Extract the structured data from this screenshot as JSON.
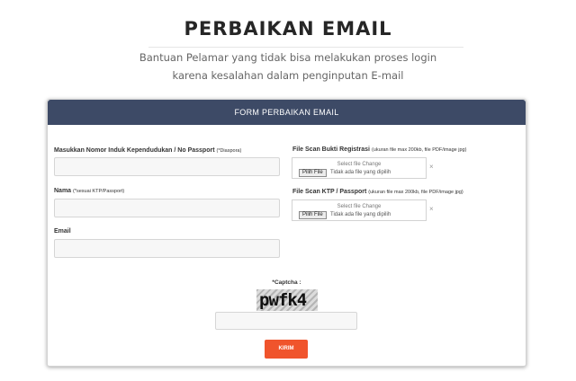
{
  "page": {
    "title": "PERBAIKAN EMAIL",
    "subtitle_line1": "Bantuan Pelamar yang tidak bisa melakukan proses login",
    "subtitle_line2": "karena kesalahan dalam penginputan E-mail"
  },
  "form": {
    "header": "FORM PERBAIKAN EMAIL",
    "nik_label": "Masukkan Nomor Induk Kependudukan / No Passport",
    "nik_note": "(*Diaspora)",
    "nik_value": "",
    "nama_label": "Nama",
    "nama_note": "(*sesuai KTP/Passport)",
    "nama_value": "",
    "email_label": "Email",
    "email_value": "",
    "file1_label": "File Scan Bukti Registrasi",
    "file1_note": "(ukuran file max 200kb, file PDF/image jpg)",
    "file2_label": "File Scan KTP / Passport",
    "file2_note": "(ukuran file max 200kb, file PDF/image jpg)",
    "file_select_text": "Select file Change",
    "file_button": "Pilih File",
    "file_none": "Tidak ada file yang dipilih",
    "remove_symbol": "×",
    "captcha_label": "*Captcha :",
    "captcha_text": "pwfk4",
    "captcha_value": "",
    "submit_label": "KIRIM"
  },
  "colors": {
    "header_bg": "#3d4a66",
    "submit_bg": "#f0542c"
  }
}
